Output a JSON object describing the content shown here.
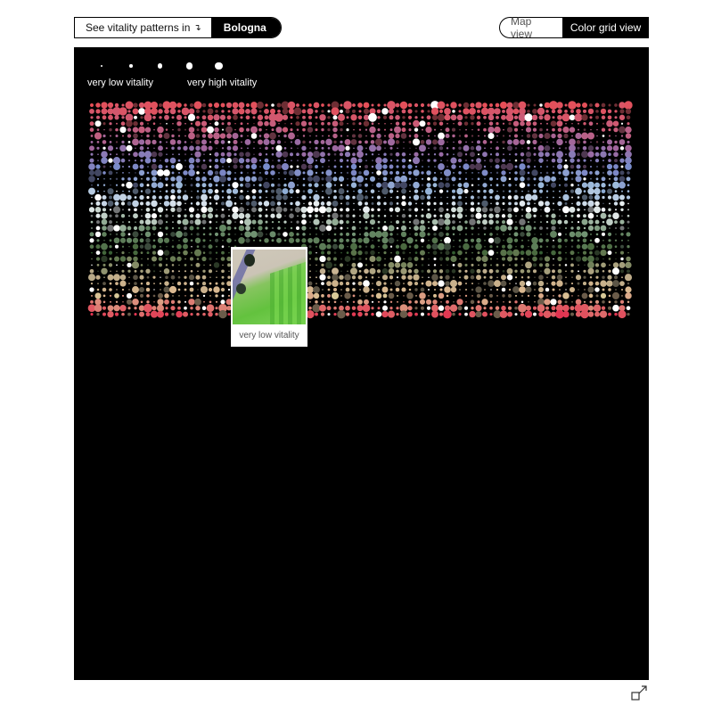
{
  "header": {
    "selector_label": "See vitality patterns in",
    "selector_arrow": "↴",
    "city": "Bologna",
    "views": {
      "map": "Map view",
      "grid": "Color grid view",
      "active": "grid"
    }
  },
  "legend": {
    "low_label": "very low vitality",
    "high_label": "very high vitality",
    "levels": 5
  },
  "tooltip": {
    "caption": "very low vitality"
  },
  "icons": {
    "fullscreen": "expand-icon",
    "thumbnail": "satellite-tile-image"
  },
  "colors": {
    "background": "#000000",
    "band_palette": [
      "#e0525f",
      "#c85c79",
      "#9b6aa2",
      "#7d88c6",
      "#9ab6d8",
      "#e8eef0",
      "#6f9070",
      "#4a6a40",
      "#b7a987",
      "#d9b890",
      "#e0525f"
    ]
  }
}
